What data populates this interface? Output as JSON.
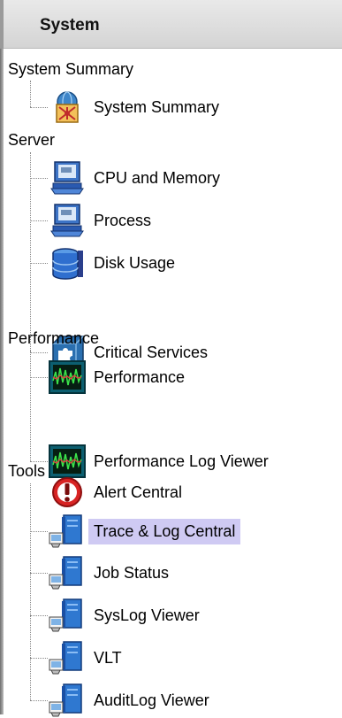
{
  "header": {
    "title": "System"
  },
  "tree": {
    "system_summary": {
      "label": "System Summary",
      "items": [
        {
          "label": "System Summary",
          "icon": "network-summary-icon"
        }
      ]
    },
    "server": {
      "label": "Server",
      "items": [
        {
          "label": "CPU and Memory",
          "icon": "computer-icon"
        },
        {
          "label": "Process",
          "icon": "computer-icon"
        },
        {
          "label": "Disk Usage",
          "icon": "database-icon"
        },
        {
          "label": "Critical Services",
          "icon": "puzzle-icon"
        }
      ]
    },
    "performance": {
      "label": "Performance",
      "items": [
        {
          "label": "Performance",
          "icon": "performance-monitor-icon"
        },
        {
          "label": "Performance Log Viewer",
          "icon": "performance-monitor-icon"
        }
      ]
    },
    "tools": {
      "label": "Tools",
      "items": [
        {
          "label": "Alert Central",
          "icon": "alert-icon"
        },
        {
          "label": "Trace & Log Central",
          "icon": "server-icon",
          "selected": true
        },
        {
          "label": "Job Status",
          "icon": "server-icon"
        },
        {
          "label": "SysLog Viewer",
          "icon": "server-icon"
        },
        {
          "label": "VLT",
          "icon": "server-icon"
        },
        {
          "label": "AuditLog Viewer",
          "icon": "server-icon"
        }
      ]
    }
  },
  "colors": {
    "selection": "#cfcaf3",
    "header_bg": "#dcdcdc"
  }
}
